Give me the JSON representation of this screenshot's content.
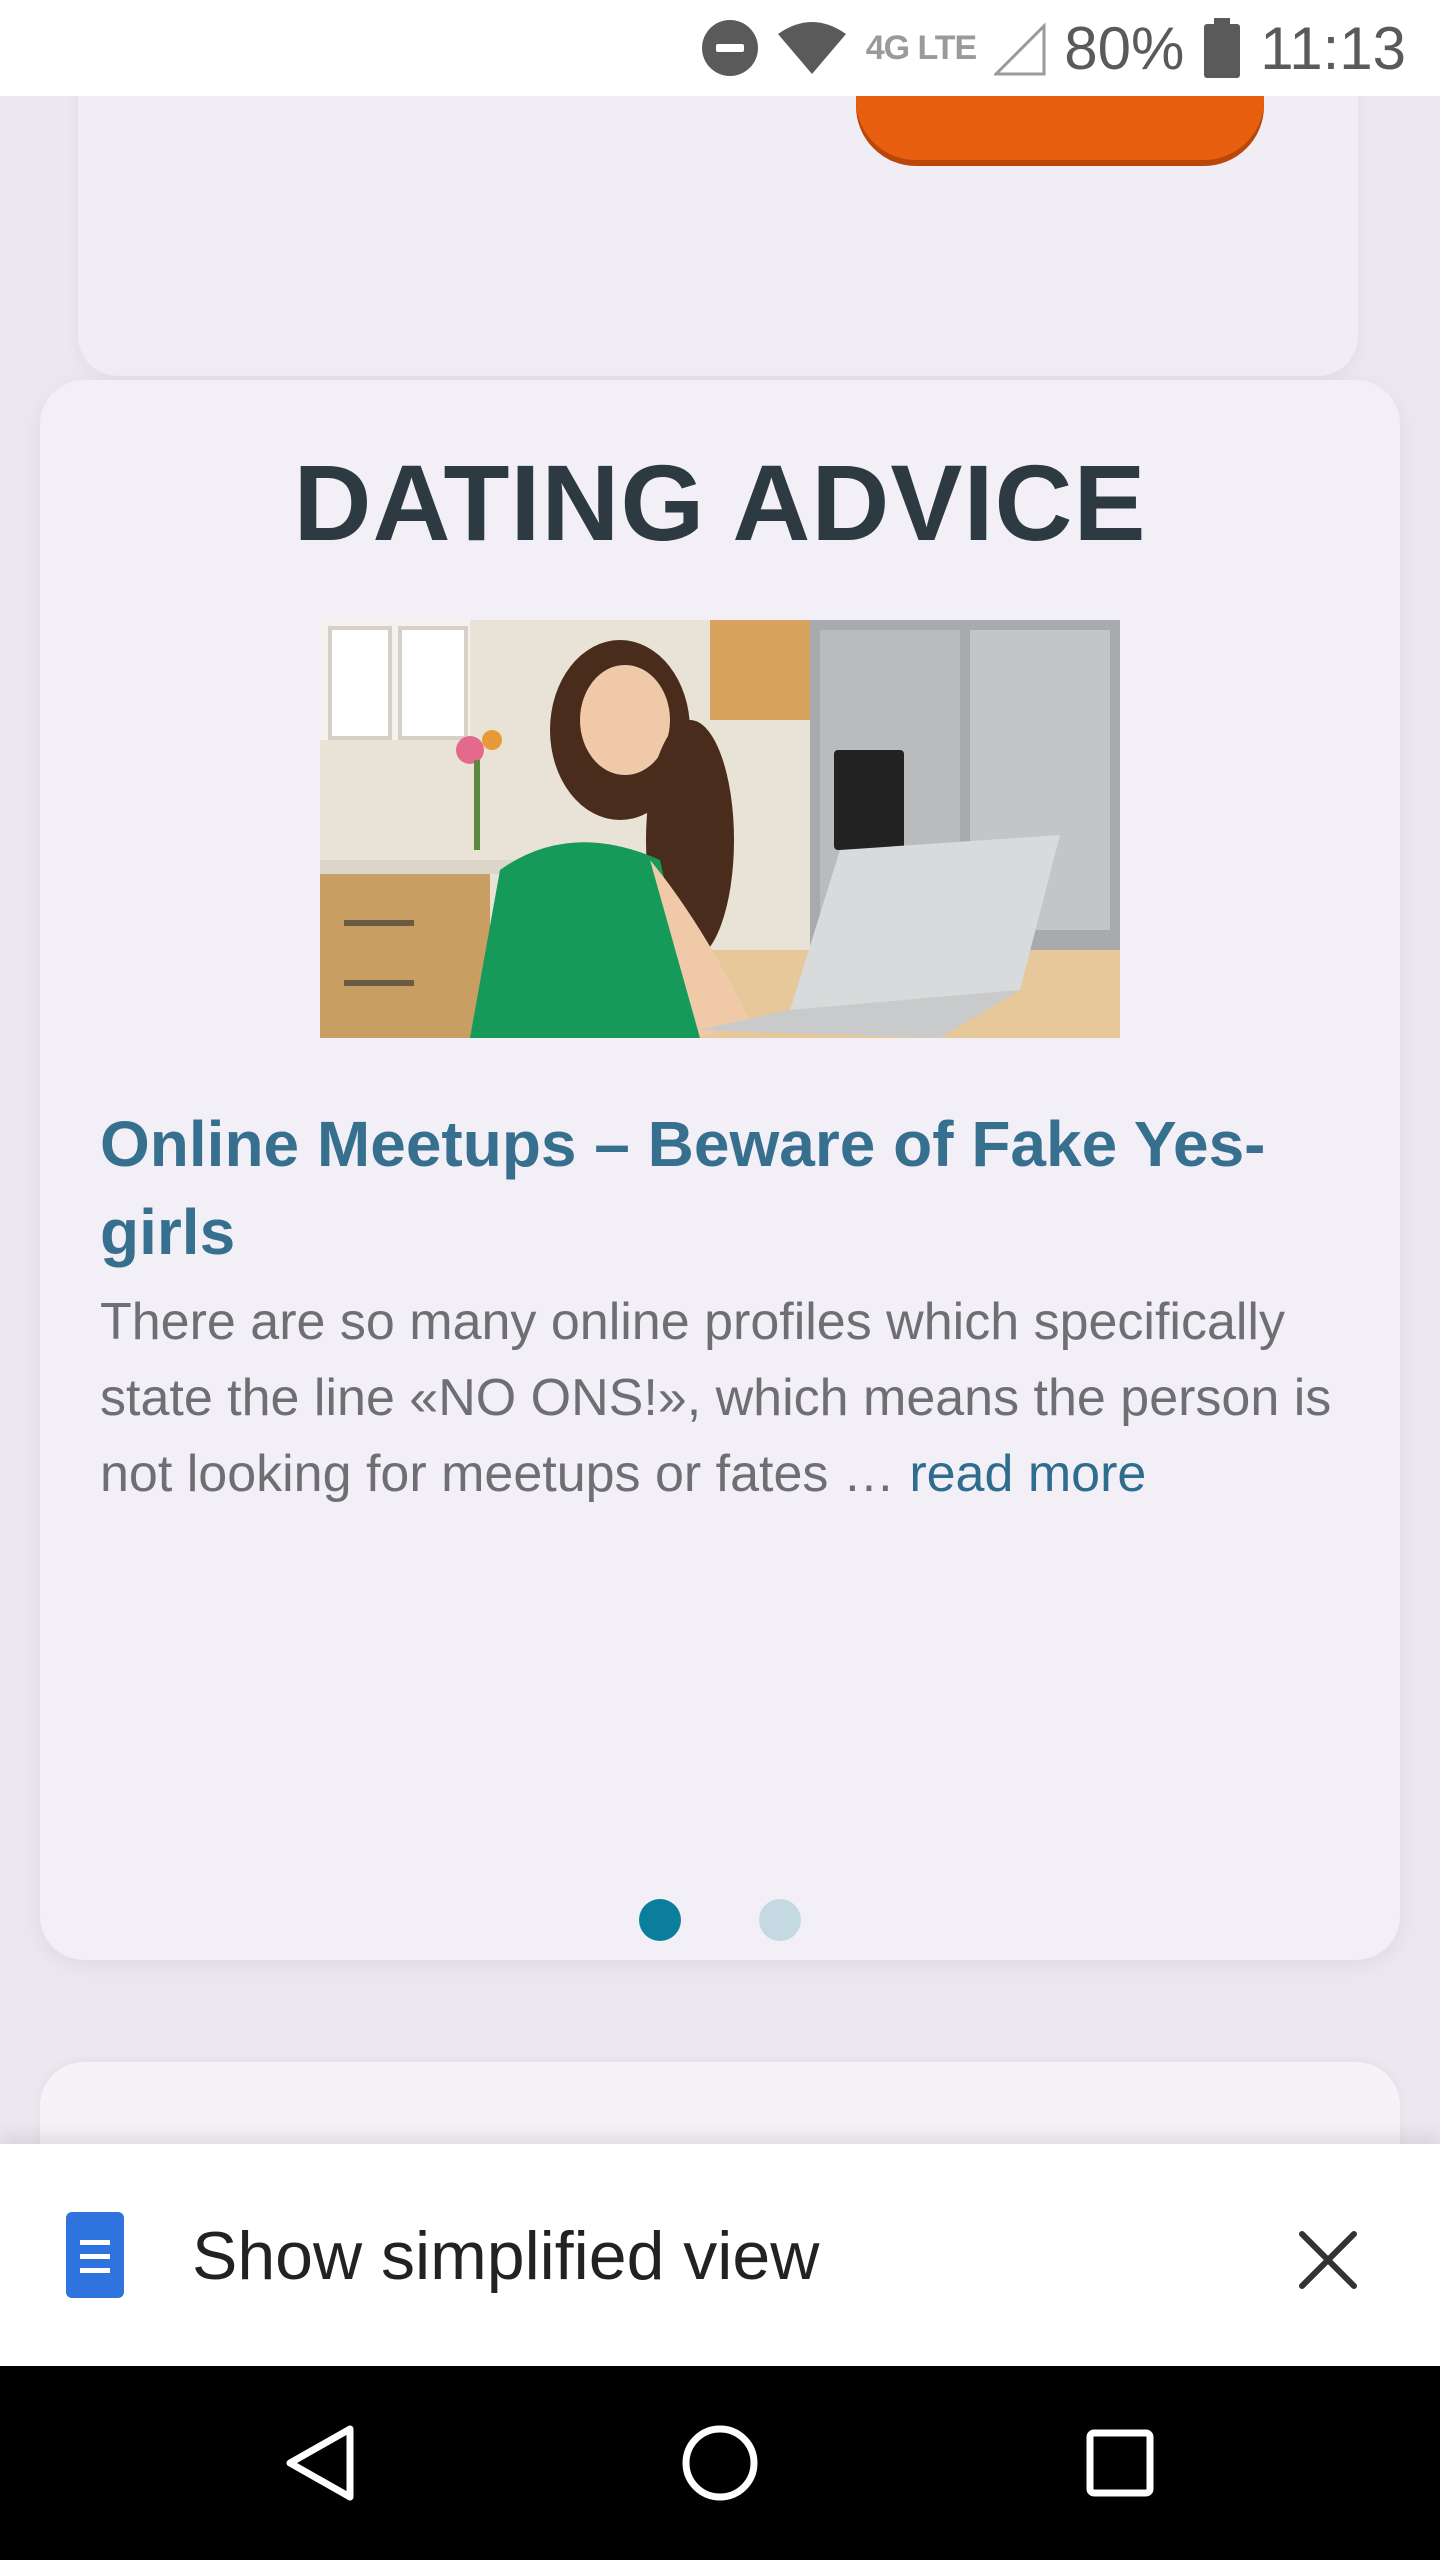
{
  "status_bar": {
    "dnd_icon": "do-not-disturb-icon",
    "wifi_icon": "wifi-icon",
    "network": "4G LTE",
    "signal_icon": "cell-signal-icon",
    "battery_percent": "80%",
    "battery_icon": "battery-icon",
    "time": "11:13"
  },
  "top_card": {
    "button_color": "#e8600f"
  },
  "advice_card": {
    "title": "DATING ADVICE",
    "post": {
      "title": "Online Meetups – Beware of Fake Yes-girls",
      "excerpt": "There are so many online profiles which specifically state the line «NO ONS!», which means the person is not looking for meetups or fates … ",
      "read_more": "read more"
    },
    "carousel": {
      "active_index": 0,
      "count": 2,
      "active_color": "#0b7e9e",
      "inactive_color": "#c4d9e2"
    }
  },
  "simplified_view": {
    "label": "Show simplified view",
    "icon": "document-icon",
    "close_icon": "close-icon"
  },
  "nav_bar": {
    "back_icon": "back-icon",
    "home_icon": "home-icon",
    "recents_icon": "recents-icon"
  }
}
